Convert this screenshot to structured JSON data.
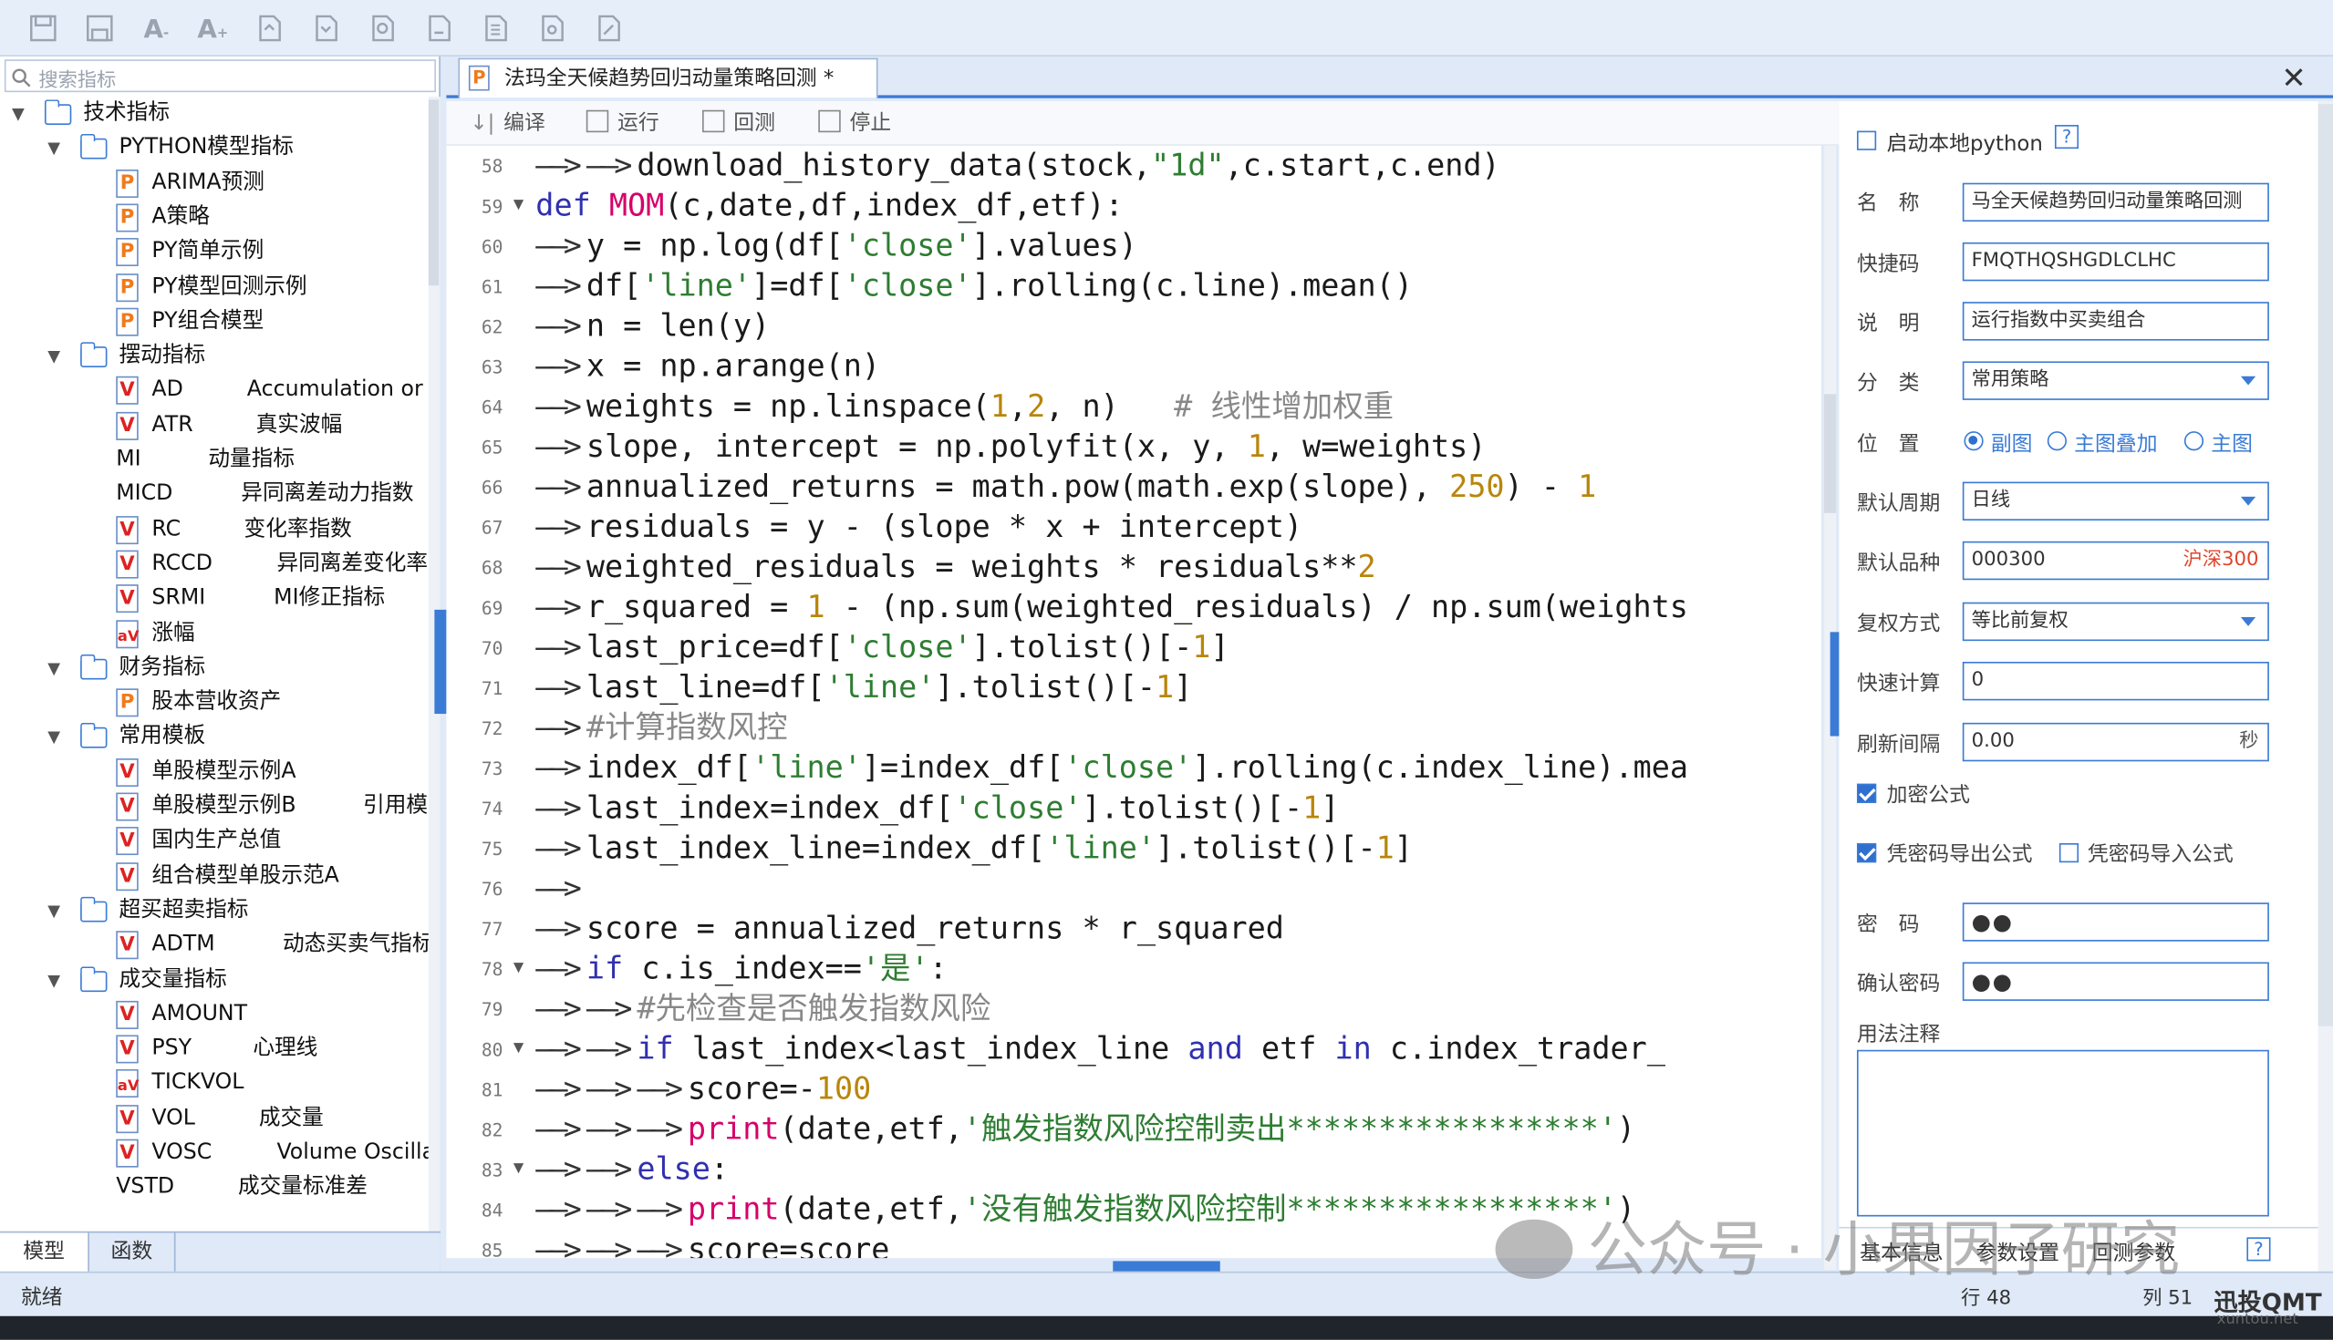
{
  "left_panel": {
    "search_placeholder": "搜索指标",
    "tree": [
      {
        "label": "技术指标",
        "type": "folder",
        "level": 0
      },
      {
        "label": "PYTHON模型指标",
        "type": "folder",
        "level": 1
      },
      {
        "label": "ARIMA预测",
        "type": "p",
        "level": 2
      },
      {
        "label": "A策略",
        "type": "p",
        "level": 2
      },
      {
        "label": "PY简单示例",
        "type": "p",
        "level": 2
      },
      {
        "label": "PY模型回测示例",
        "type": "p",
        "level": 2
      },
      {
        "label": "PY组合模型",
        "type": "p",
        "level": 2
      },
      {
        "label": "摆动指标",
        "type": "folder",
        "level": 1
      },
      {
        "label": "AD",
        "desc": "Accumulation or",
        "type": "v",
        "level": 2
      },
      {
        "label": "ATR",
        "desc": "真实波幅",
        "type": "v",
        "level": 2
      },
      {
        "label": "MI",
        "desc": "动量指标",
        "type": "none",
        "level": 2
      },
      {
        "label": "MICD",
        "desc": "异同离差动力指数",
        "type": "none",
        "level": 2
      },
      {
        "label": "RC",
        "desc": "变化率指数",
        "type": "v",
        "level": 2
      },
      {
        "label": "RCCD",
        "desc": "异同离差变化率",
        "type": "v",
        "level": 2
      },
      {
        "label": "SRMI",
        "desc": "MI修正指标",
        "type": "v",
        "level": 2
      },
      {
        "label": "涨幅",
        "type": "av",
        "level": 2
      },
      {
        "label": "财务指标",
        "type": "folder",
        "level": 1
      },
      {
        "label": "股本营收资产",
        "type": "p",
        "level": 2
      },
      {
        "label": "常用模板",
        "type": "folder",
        "level": 1
      },
      {
        "label": "单股模型示例A",
        "type": "v",
        "level": 2
      },
      {
        "label": "单股模型示例B",
        "desc": "引用模",
        "type": "v",
        "level": 2
      },
      {
        "label": "国内生产总值",
        "type": "v",
        "level": 2
      },
      {
        "label": "组合模型单股示范A",
        "type": "v",
        "level": 2
      },
      {
        "label": "超买超卖指标",
        "type": "folder",
        "level": 1
      },
      {
        "label": "ADTM",
        "desc": "动态买卖气指标",
        "type": "v",
        "level": 2
      },
      {
        "label": "成交量指标",
        "type": "folder",
        "level": 1
      },
      {
        "label": "AMOUNT",
        "type": "v",
        "level": 2
      },
      {
        "label": "PSY",
        "desc": "心理线",
        "type": "v",
        "level": 2
      },
      {
        "label": "TICKVOL",
        "type": "av",
        "level": 2
      },
      {
        "label": "VOL",
        "desc": "成交量",
        "type": "v",
        "level": 2
      },
      {
        "label": "VOSC",
        "desc": "Volume Oscilla",
        "type": "v",
        "level": 2
      },
      {
        "label": "VSTD",
        "desc": "成交量标准差",
        "type": "none",
        "level": 2
      }
    ],
    "tabs": [
      "模型",
      "函数"
    ]
  },
  "editor": {
    "tab_title": "法玛全天候趋势回归动量策略回测 *",
    "close_label": "✕",
    "tools": [
      "编译",
      "运行",
      "回测",
      "停止"
    ],
    "lines": [
      {
        "no": "58",
        "fold": "",
        "indent": 2,
        "tokens": [
          [
            "t",
            "download_history_data(stock,"
          ],
          [
            "s",
            "\"1d\""
          ],
          [
            "t",
            ",c.start,c.end)"
          ]
        ]
      },
      {
        "no": "59",
        "fold": "▼",
        "indent": 0,
        "tokens": [
          [
            "k",
            "def "
          ],
          [
            "fn",
            "MOM"
          ],
          [
            "t",
            "(c,date,df,index_df,etf):"
          ]
        ]
      },
      {
        "no": "60",
        "fold": "",
        "indent": 1,
        "tokens": [
          [
            "t",
            "y = np.log(df["
          ],
          [
            "s",
            "'close'"
          ],
          [
            "t",
            "].values)"
          ]
        ]
      },
      {
        "no": "61",
        "fold": "",
        "indent": 1,
        "tokens": [
          [
            "t",
            "df["
          ],
          [
            "s",
            "'line'"
          ],
          [
            "t",
            "]=df["
          ],
          [
            "s",
            "'close'"
          ],
          [
            "t",
            "].rolling(c.line).mean()"
          ]
        ]
      },
      {
        "no": "62",
        "fold": "",
        "indent": 1,
        "tokens": [
          [
            "t",
            "n = len(y)"
          ]
        ]
      },
      {
        "no": "63",
        "fold": "",
        "indent": 1,
        "tokens": [
          [
            "t",
            "x = np.arange(n)"
          ]
        ]
      },
      {
        "no": "64",
        "fold": "",
        "indent": 1,
        "tokens": [
          [
            "t",
            "weights = np.linspace("
          ],
          [
            "n",
            "1"
          ],
          [
            "t",
            ","
          ],
          [
            "n",
            "2"
          ],
          [
            "t",
            ", n)   "
          ],
          [
            "c",
            "# 线性增加权重"
          ]
        ]
      },
      {
        "no": "65",
        "fold": "",
        "indent": 1,
        "tokens": [
          [
            "t",
            "slope, intercept = np.polyfit(x, y, "
          ],
          [
            "n",
            "1"
          ],
          [
            "t",
            ", w=weights)"
          ]
        ]
      },
      {
        "no": "66",
        "fold": "",
        "indent": 1,
        "tokens": [
          [
            "t",
            "annualized_returns = math.pow(math.exp(slope), "
          ],
          [
            "n",
            "250"
          ],
          [
            "t",
            ") - "
          ],
          [
            "n",
            "1"
          ]
        ]
      },
      {
        "no": "67",
        "fold": "",
        "indent": 1,
        "tokens": [
          [
            "t",
            "residuals = y - (slope * x + intercept)"
          ]
        ]
      },
      {
        "no": "68",
        "fold": "",
        "indent": 1,
        "tokens": [
          [
            "t",
            "weighted_residuals = weights * residuals**"
          ],
          [
            "n",
            "2"
          ]
        ]
      },
      {
        "no": "69",
        "fold": "",
        "indent": 1,
        "tokens": [
          [
            "t",
            "r_squared = "
          ],
          [
            "n",
            "1"
          ],
          [
            "t",
            " - (np.sum(weighted_residuals) / np.sum(weights"
          ]
        ]
      },
      {
        "no": "70",
        "fold": "",
        "indent": 1,
        "tokens": [
          [
            "t",
            "last_price=df["
          ],
          [
            "s",
            "'close'"
          ],
          [
            "t",
            "].tolist()[-"
          ],
          [
            "n",
            "1"
          ],
          [
            "t",
            "]"
          ]
        ]
      },
      {
        "no": "71",
        "fold": "",
        "indent": 1,
        "tokens": [
          [
            "t",
            "last_line=df["
          ],
          [
            "s",
            "'line'"
          ],
          [
            "t",
            "].tolist()[-"
          ],
          [
            "n",
            "1"
          ],
          [
            "t",
            "]"
          ]
        ]
      },
      {
        "no": "72",
        "fold": "",
        "indent": 1,
        "tokens": [
          [
            "c",
            "#计算指数风控"
          ]
        ]
      },
      {
        "no": "73",
        "fold": "",
        "indent": 1,
        "tokens": [
          [
            "t",
            "index_df["
          ],
          [
            "s",
            "'line'"
          ],
          [
            "t",
            "]=index_df["
          ],
          [
            "s",
            "'close'"
          ],
          [
            "t",
            "].rolling(c.index_line).mea"
          ]
        ]
      },
      {
        "no": "74",
        "fold": "",
        "indent": 1,
        "tokens": [
          [
            "t",
            "last_index=index_df["
          ],
          [
            "s",
            "'close'"
          ],
          [
            "t",
            "].tolist()[-"
          ],
          [
            "n",
            "1"
          ],
          [
            "t",
            "]"
          ]
        ]
      },
      {
        "no": "75",
        "fold": "",
        "indent": 1,
        "tokens": [
          [
            "t",
            "last_index_line=index_df["
          ],
          [
            "s",
            "'line'"
          ],
          [
            "t",
            "].tolist()[-"
          ],
          [
            "n",
            "1"
          ],
          [
            "t",
            "]"
          ]
        ]
      },
      {
        "no": "76",
        "fold": "",
        "indent": 1,
        "tokens": []
      },
      {
        "no": "77",
        "fold": "",
        "indent": 1,
        "tokens": [
          [
            "t",
            "score = annualized_returns * r_squared"
          ]
        ]
      },
      {
        "no": "78",
        "fold": "▼",
        "indent": 1,
        "tokens": [
          [
            "k",
            "if "
          ],
          [
            "t",
            "c.is_index=="
          ],
          [
            "s",
            "'是'"
          ],
          [
            "t",
            ":"
          ]
        ]
      },
      {
        "no": "79",
        "fold": "",
        "indent": 2,
        "tokens": [
          [
            "c",
            "#先检查是否触发指数风险"
          ]
        ]
      },
      {
        "no": "80",
        "fold": "▼",
        "indent": 2,
        "tokens": [
          [
            "k",
            "if "
          ],
          [
            "t",
            "last_index<last_index_line "
          ],
          [
            "k",
            "and "
          ],
          [
            "t",
            "etf "
          ],
          [
            "k",
            "in "
          ],
          [
            "t",
            "c.index_trader_"
          ]
        ]
      },
      {
        "no": "81",
        "fold": "",
        "indent": 3,
        "tokens": [
          [
            "t",
            "score=-"
          ],
          [
            "n",
            "100"
          ]
        ]
      },
      {
        "no": "82",
        "fold": "",
        "indent": 3,
        "tokens": [
          [
            "fn",
            "print"
          ],
          [
            "t",
            "(date,etf,"
          ],
          [
            "s",
            "'触发指数风险控制卖出*****************'"
          ],
          [
            "t",
            ")"
          ]
        ]
      },
      {
        "no": "83",
        "fold": "▼",
        "indent": 2,
        "tokens": [
          [
            "k",
            "else"
          ],
          [
            "t",
            ":"
          ]
        ]
      },
      {
        "no": "84",
        "fold": "",
        "indent": 3,
        "tokens": [
          [
            "fn",
            "print"
          ],
          [
            "t",
            "(date,etf,"
          ],
          [
            "s",
            "'没有触发指数风险控制*****************'"
          ],
          [
            "t",
            ")"
          ]
        ]
      },
      {
        "no": "85",
        "fold": "",
        "indent": 3,
        "tokens": [
          [
            "t",
            "score=score"
          ]
        ]
      }
    ]
  },
  "props": {
    "local_python_label": "启动本地python",
    "help": "?",
    "name_label": "名　称",
    "name_value": "马全天候趋势回归动量策略回测",
    "shortcut_label": "快捷码",
    "shortcut_value": "FMQTHQSHGDLCLHC",
    "desc_label": "说　明",
    "desc_value": "运行指数中买卖组合",
    "category_label": "分　类",
    "category_value": "常用策略",
    "position_label": "位　置",
    "radio_sub": "副图",
    "radio_overlay": "主图叠加",
    "radio_main": "主图",
    "period_label": "默认周期",
    "period_value": "日线",
    "symbol_label": "默认品种",
    "symbol_value": "000300",
    "symbol_name": "沪深300",
    "adjust_label": "复权方式",
    "adjust_value": "等比前复权",
    "quick_calc_label": "快速计算",
    "quick_calc_value": "0",
    "refresh_label": "刷新间隔",
    "refresh_value": "0.00",
    "refresh_unit": "秒",
    "encrypt_label": "加密公式",
    "export_label": "凭密码导出公式",
    "import_label": "凭密码导入公式",
    "password_label": "密　码",
    "password_value": "●●",
    "confirm_label": "确认密码",
    "confirm_value": "●●",
    "notes_label": "用法注释",
    "tabs": [
      "基本信息",
      "参数设置",
      "回测参数"
    ],
    "tab_help": "?"
  },
  "status": {
    "left": "就绪",
    "row": "行 48",
    "col": "列 51"
  },
  "watermark": {
    "text": "公众号 · 小果因子研究",
    "brand": "迅投QMT",
    "brand_url": "xuntou.net"
  },
  "colors": {
    "accent": "#3a7bd5",
    "keyword": "#3030b0",
    "string": "#2e7d32",
    "number": "#b8860b",
    "function": "#d6006a"
  }
}
